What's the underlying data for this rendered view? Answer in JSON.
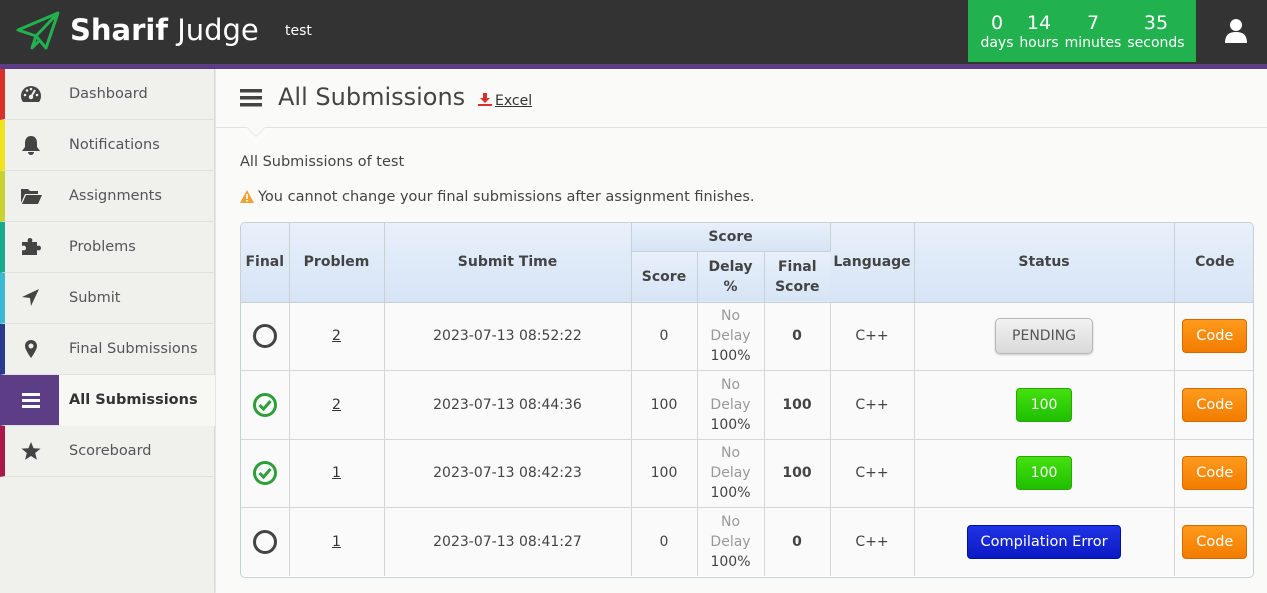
{
  "header": {
    "brand_bold": "Sharif",
    "brand_rest": "Judge",
    "assignment": "test",
    "countdown": [
      {
        "value": "0",
        "label": "days"
      },
      {
        "value": "14",
        "label": "hours"
      },
      {
        "value": "7",
        "label": "minutes"
      },
      {
        "value": "35",
        "label": "seconds"
      }
    ],
    "countdown_color": "#21b14e"
  },
  "sidebar": {
    "items": [
      {
        "label": "Dashboard",
        "icon": "dashboard-icon",
        "color": "#d9302a"
      },
      {
        "label": "Notifications",
        "icon": "bell-icon",
        "color": "#f0e21c"
      },
      {
        "label": "Assignments",
        "icon": "folder-open-icon",
        "color": "#c7d332"
      },
      {
        "label": "Problems",
        "icon": "puzzle-icon",
        "color": "#1aa88f"
      },
      {
        "label": "Submit",
        "icon": "location-arrow-icon",
        "color": "#3cb8d0"
      },
      {
        "label": "Final Submissions",
        "icon": "map-marker-icon",
        "color": "#2a3a8c"
      },
      {
        "label": "All Submissions",
        "icon": "list-icon",
        "color": "#5c3d86"
      },
      {
        "label": "Scoreboard",
        "icon": "star-icon",
        "color": "#a8194a"
      }
    ],
    "active_index": 6
  },
  "main": {
    "title": "All Submissions",
    "excel_label": "Excel",
    "subtitle": "All Submissions of test",
    "warning": "You cannot change your final submissions after assignment finishes."
  },
  "table": {
    "headers": {
      "final": "Final",
      "problem": "Problem",
      "submit_time": "Submit Time",
      "score_group": "Score",
      "score": "Score",
      "delay_1": "Delay",
      "delay_2": "%",
      "final_score_1": "Final",
      "final_score_2": "Score",
      "language": "Language",
      "status": "Status",
      "code": "Code"
    },
    "rows": [
      {
        "final": false,
        "problem": "2",
        "time": "2023-07-13 08:52:22",
        "score": "0",
        "delay_1": "No",
        "delay_2": "Delay",
        "delay_pct": "100%",
        "final_score": "0",
        "language": "C++",
        "status": "PENDING",
        "status_type": "pending",
        "code": "Code"
      },
      {
        "final": true,
        "problem": "2",
        "time": "2023-07-13 08:44:36",
        "score": "100",
        "delay_1": "No",
        "delay_2": "Delay",
        "delay_pct": "100%",
        "final_score": "100",
        "language": "C++",
        "status": "100",
        "status_type": "score",
        "code": "Code"
      },
      {
        "final": true,
        "problem": "1",
        "time": "2023-07-13 08:42:23",
        "score": "100",
        "delay_1": "No",
        "delay_2": "Delay",
        "delay_pct": "100%",
        "final_score": "100",
        "language": "C++",
        "status": "100",
        "status_type": "score",
        "code": "Code"
      },
      {
        "final": false,
        "problem": "1",
        "time": "2023-07-13 08:41:27",
        "score": "0",
        "delay_1": "No",
        "delay_2": "Delay",
        "delay_pct": "100%",
        "final_score": "0",
        "language": "C++",
        "status": "Compilation Error",
        "status_type": "error",
        "code": "Code"
      }
    ]
  }
}
